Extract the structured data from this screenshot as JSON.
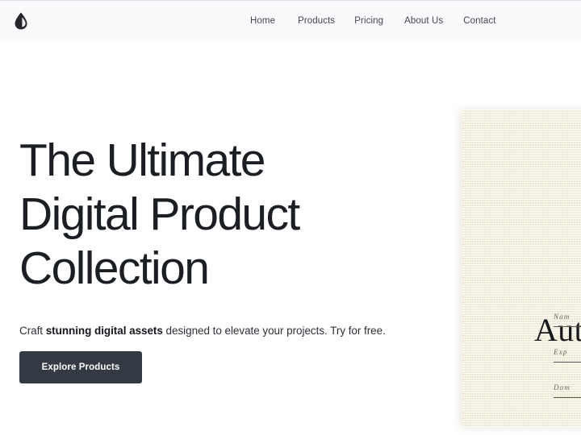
{
  "header": {
    "logo_icon": "leaf-drop-logo-icon",
    "nav": [
      {
        "label": "Home"
      },
      {
        "label": "Products"
      },
      {
        "label": "Pricing"
      },
      {
        "label": "About Us"
      },
      {
        "label": "Contact"
      }
    ]
  },
  "hero": {
    "title_line_1": "The Ultimate",
    "title_line_2": "Digital Product",
    "title_line_3": "Collection",
    "subtitle_prefix": "Craft ",
    "subtitle_bold": "stunning digital assets",
    "subtitle_suffix": " designed to elevate your projects. Try for free.",
    "cta_label": "Explore Products",
    "cta_color": "#343a43"
  },
  "certificate_card": {
    "title": "Aut",
    "background_color": "#f5f3e9",
    "fields": [
      {
        "label": "Nam"
      },
      {
        "label": "Exp"
      },
      {
        "label": "Dom"
      }
    ]
  }
}
